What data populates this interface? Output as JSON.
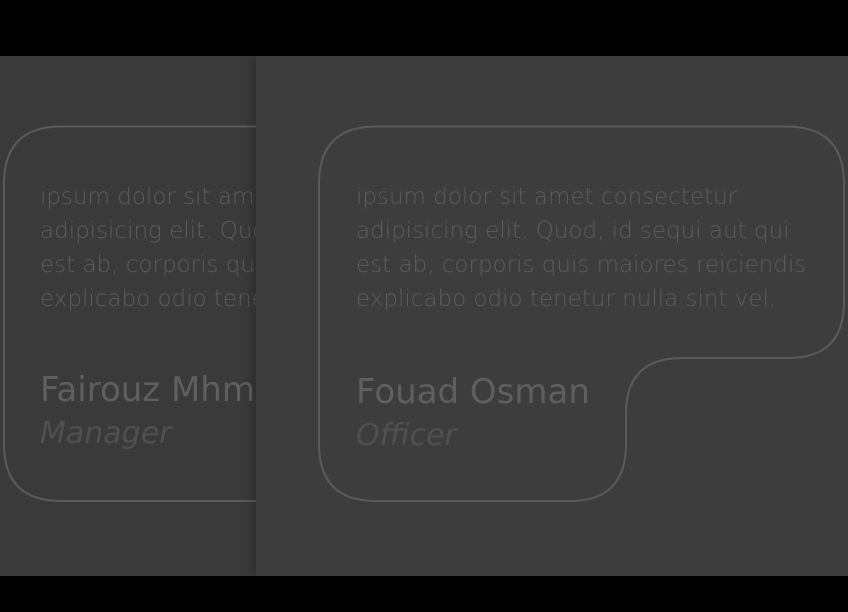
{
  "colors": {
    "background": "#000000",
    "stage": "#3b3b3b",
    "outline": "#5a5a5a",
    "text": "#5c5c5c"
  },
  "cards": [
    {
      "quote_lines": [
        "ipsum dolor sit amet consectetur",
        "adipisicing elit. Quod, id sequi aut qui",
        "est ab, corporis quis maiores reiciendis",
        "explicabo odio tenetur nulla sint vel."
      ],
      "name": "Fairouz Mhmd",
      "role": "Manager"
    },
    {
      "quote_lines": [
        "ipsum dolor sit amet consectetur",
        "adipisicing elit. Quod, id sequi aut qui",
        "est ab, corporis quis maiores reiciendis",
        "explicabo odio tenetur nulla sint vel."
      ],
      "name": "Fouad Osman",
      "role": "Officer"
    }
  ]
}
